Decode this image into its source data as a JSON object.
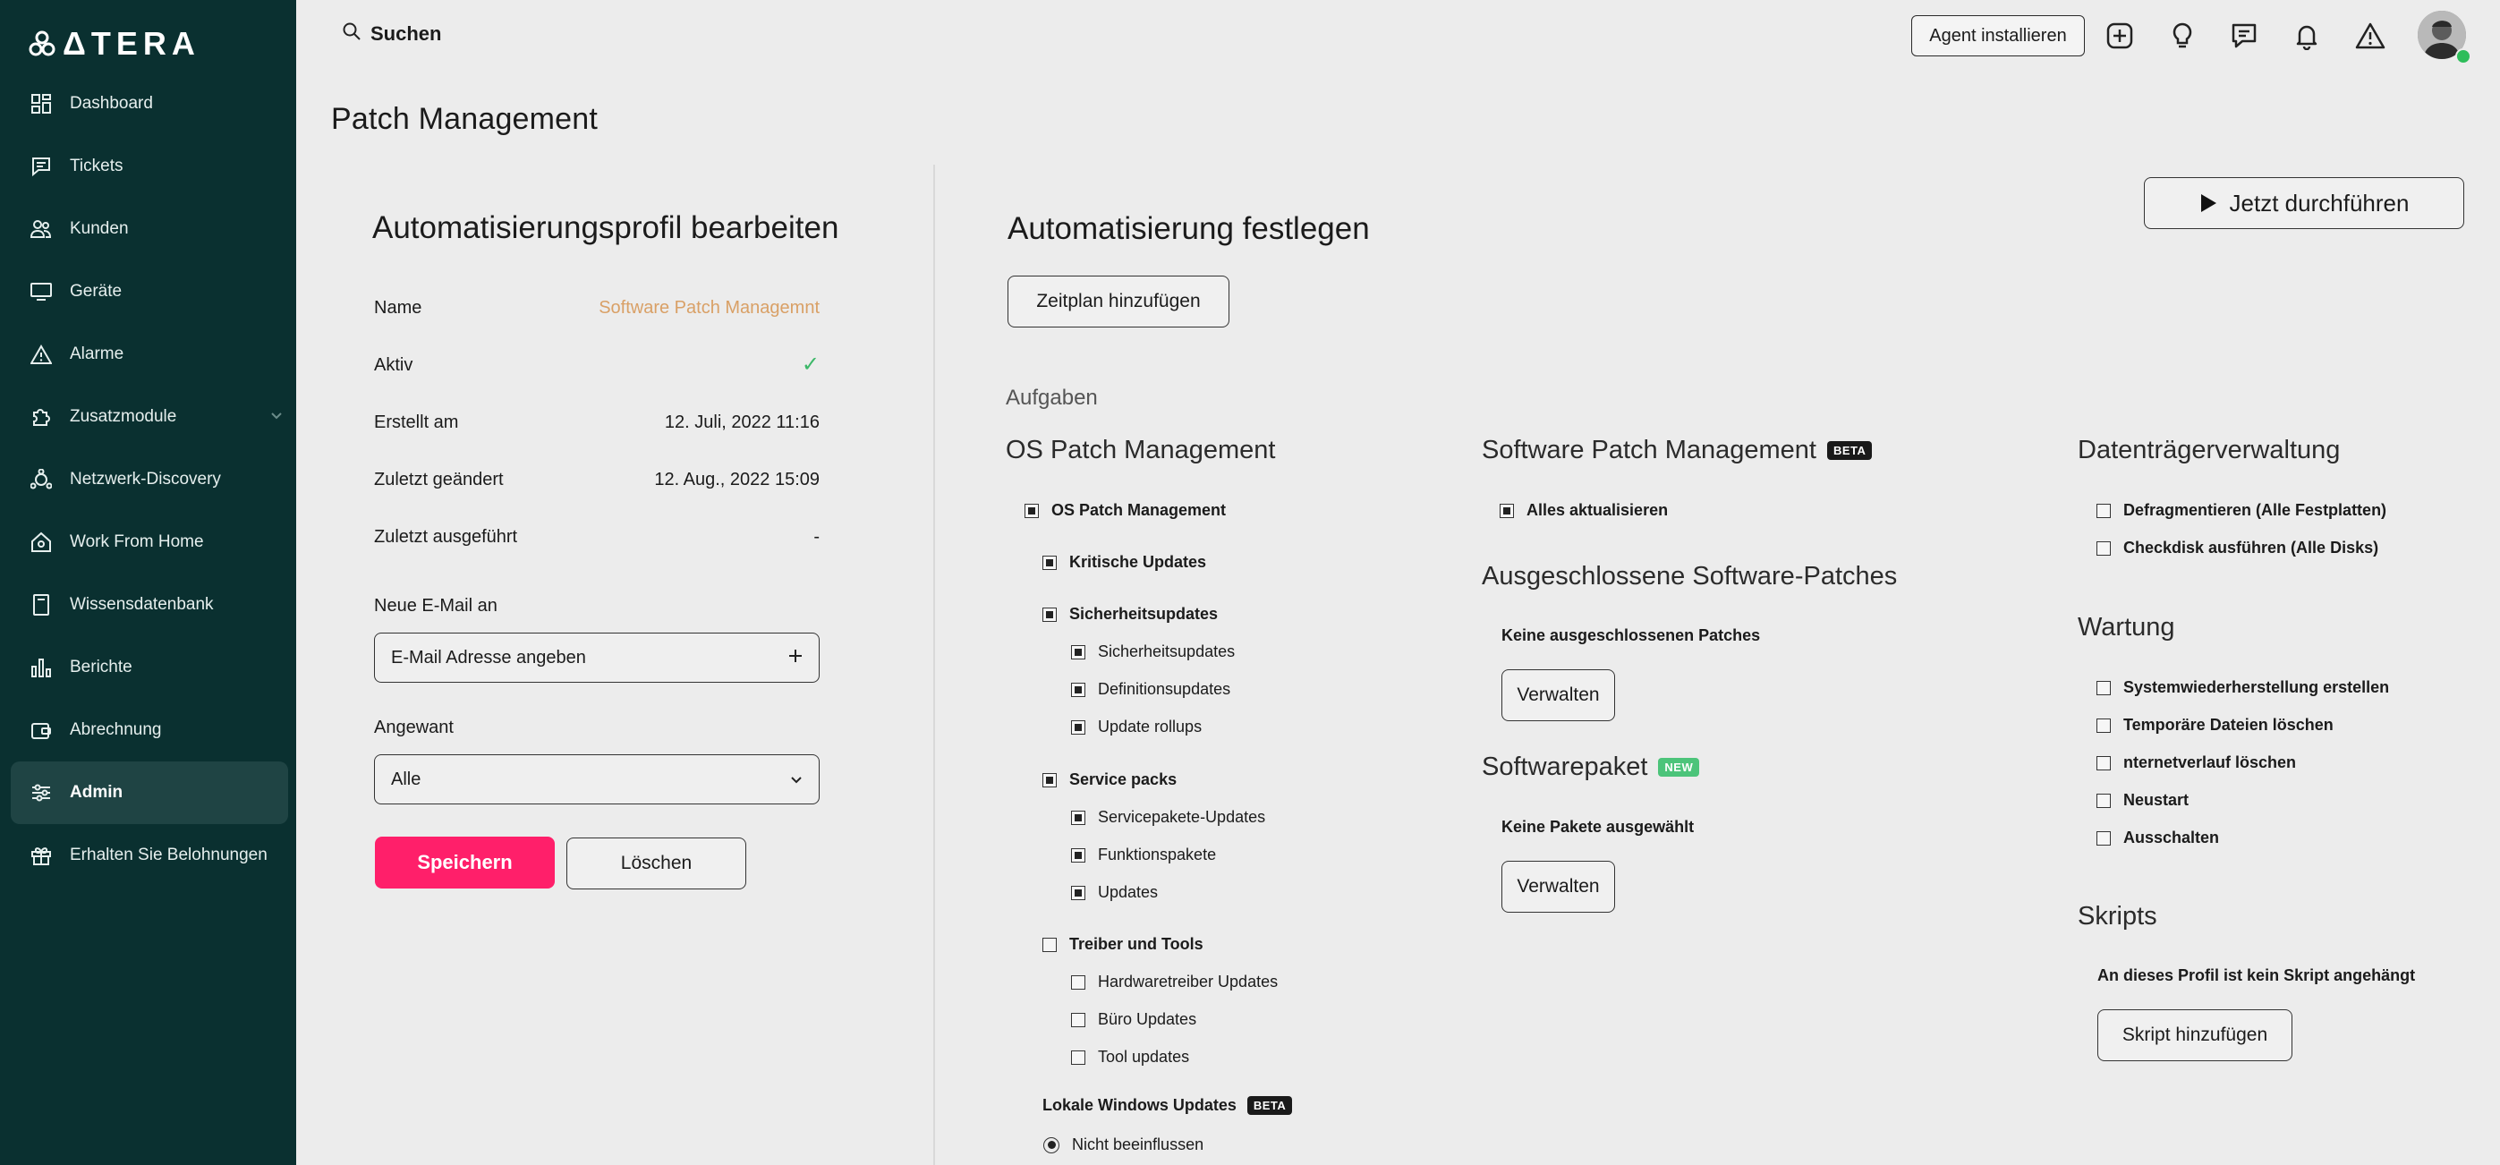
{
  "sidebar": {
    "logo_text": "ΔTERA",
    "items": [
      {
        "label": "Dashboard",
        "icon": "grid-icon"
      },
      {
        "label": "Tickets",
        "icon": "chat-icon"
      },
      {
        "label": "Kunden",
        "icon": "users-icon"
      },
      {
        "label": "Geräte",
        "icon": "monitor-icon"
      },
      {
        "label": "Alarme",
        "icon": "alert-icon"
      },
      {
        "label": "Zusatzmodule",
        "icon": "puzzle-icon"
      },
      {
        "label": "Netzwerk-Discovery",
        "icon": "network-icon"
      },
      {
        "label": "Work From Home",
        "icon": "home-icon"
      },
      {
        "label": "Wissensdatenbank",
        "icon": "book-icon"
      },
      {
        "label": "Berichte",
        "icon": "bar-chart-icon"
      },
      {
        "label": "Abrechnung",
        "icon": "wallet-icon"
      },
      {
        "label": "Admin",
        "icon": "sliders-icon"
      },
      {
        "label": "Erhalten Sie Belohnungen",
        "icon": "gift-icon"
      }
    ]
  },
  "header": {
    "search_label": "Suchen",
    "agent_button": "Agent installieren"
  },
  "page_title": "Patch Management",
  "profile": {
    "title": "Automatisierungsprofil bearbeiten",
    "rows": [
      {
        "label": "Name",
        "value": "Software Patch Managemnt"
      },
      {
        "label": "Aktiv",
        "value": "✓"
      },
      {
        "label": "Erstellt am",
        "value": "12. Juli, 2022 11:16"
      },
      {
        "label": "Zuletzt geändert",
        "value": "12. Aug., 2022 15:09"
      },
      {
        "label": "Zuletzt ausgeführt",
        "value": "-"
      }
    ],
    "email_label": "Neue E-Mail an",
    "email_placeholder": "E-Mail Adresse angeben",
    "applied_label": "Angewant",
    "applied_value": "Alle",
    "save": "Speichern",
    "delete": "Löschen"
  },
  "automation": {
    "title": "Automatisierung festlegen",
    "run_now": "Jetzt durchführen",
    "add_schedule": "Zeitplan hinzufügen",
    "tasks_label": "Aufgaben"
  },
  "os_patch": {
    "title": "OS Patch Management",
    "root": "OS Patch Management",
    "groups": [
      {
        "label": "Kritische Updates",
        "children": []
      },
      {
        "label": "Sicherheitsupdates",
        "children": [
          "Sicherheitsupdates",
          "Definitionsupdates",
          "Update rollups"
        ]
      },
      {
        "label": "Service packs",
        "children": [
          "Servicepakete-Updates",
          "Funktionspakete",
          "Updates"
        ]
      },
      {
        "label": "Treiber und Tools",
        "children": [
          "Hardwaretreiber Updates",
          "Büro Updates",
          "Tool updates"
        ]
      }
    ],
    "local_windows": "Lokale Windows Updates",
    "local_badge": "BETA",
    "radio_option": "Nicht beeinflussen"
  },
  "software_patch": {
    "title": "Software Patch Management",
    "badge": "BETA",
    "update_all": "Alles aktualisieren",
    "excluded_title": "Ausgeschlossene Software-Patches",
    "excluded_note": "Keine ausgeschlossenen Patches",
    "manage": "Verwalten",
    "package_title": "Softwarepaket",
    "package_badge": "NEW",
    "package_note": "Keine Pakete ausgewählt",
    "manage2": "Verwalten"
  },
  "disk": {
    "title": "Datenträgerverwaltung",
    "items": [
      "Defragmentieren (Alle Festplatten)",
      "Checkdisk ausführen (Alle Disks)"
    ]
  },
  "maintenance": {
    "title": "Wartung",
    "items": [
      "Systemwiederherstellung erstellen",
      "Temporäre Dateien löschen",
      "nternetverlauf löschen",
      "Neustart",
      "Ausschalten"
    ]
  },
  "scripts": {
    "title": "Skripts",
    "note": "An dieses Profil ist kein Skript angehängt",
    "add": "Skript hinzufügen"
  },
  "colors": {
    "sidebar": "#0a3030",
    "accent": "#ff1f6a",
    "name_value": "#d9a066",
    "check_green": "#3cb868"
  }
}
